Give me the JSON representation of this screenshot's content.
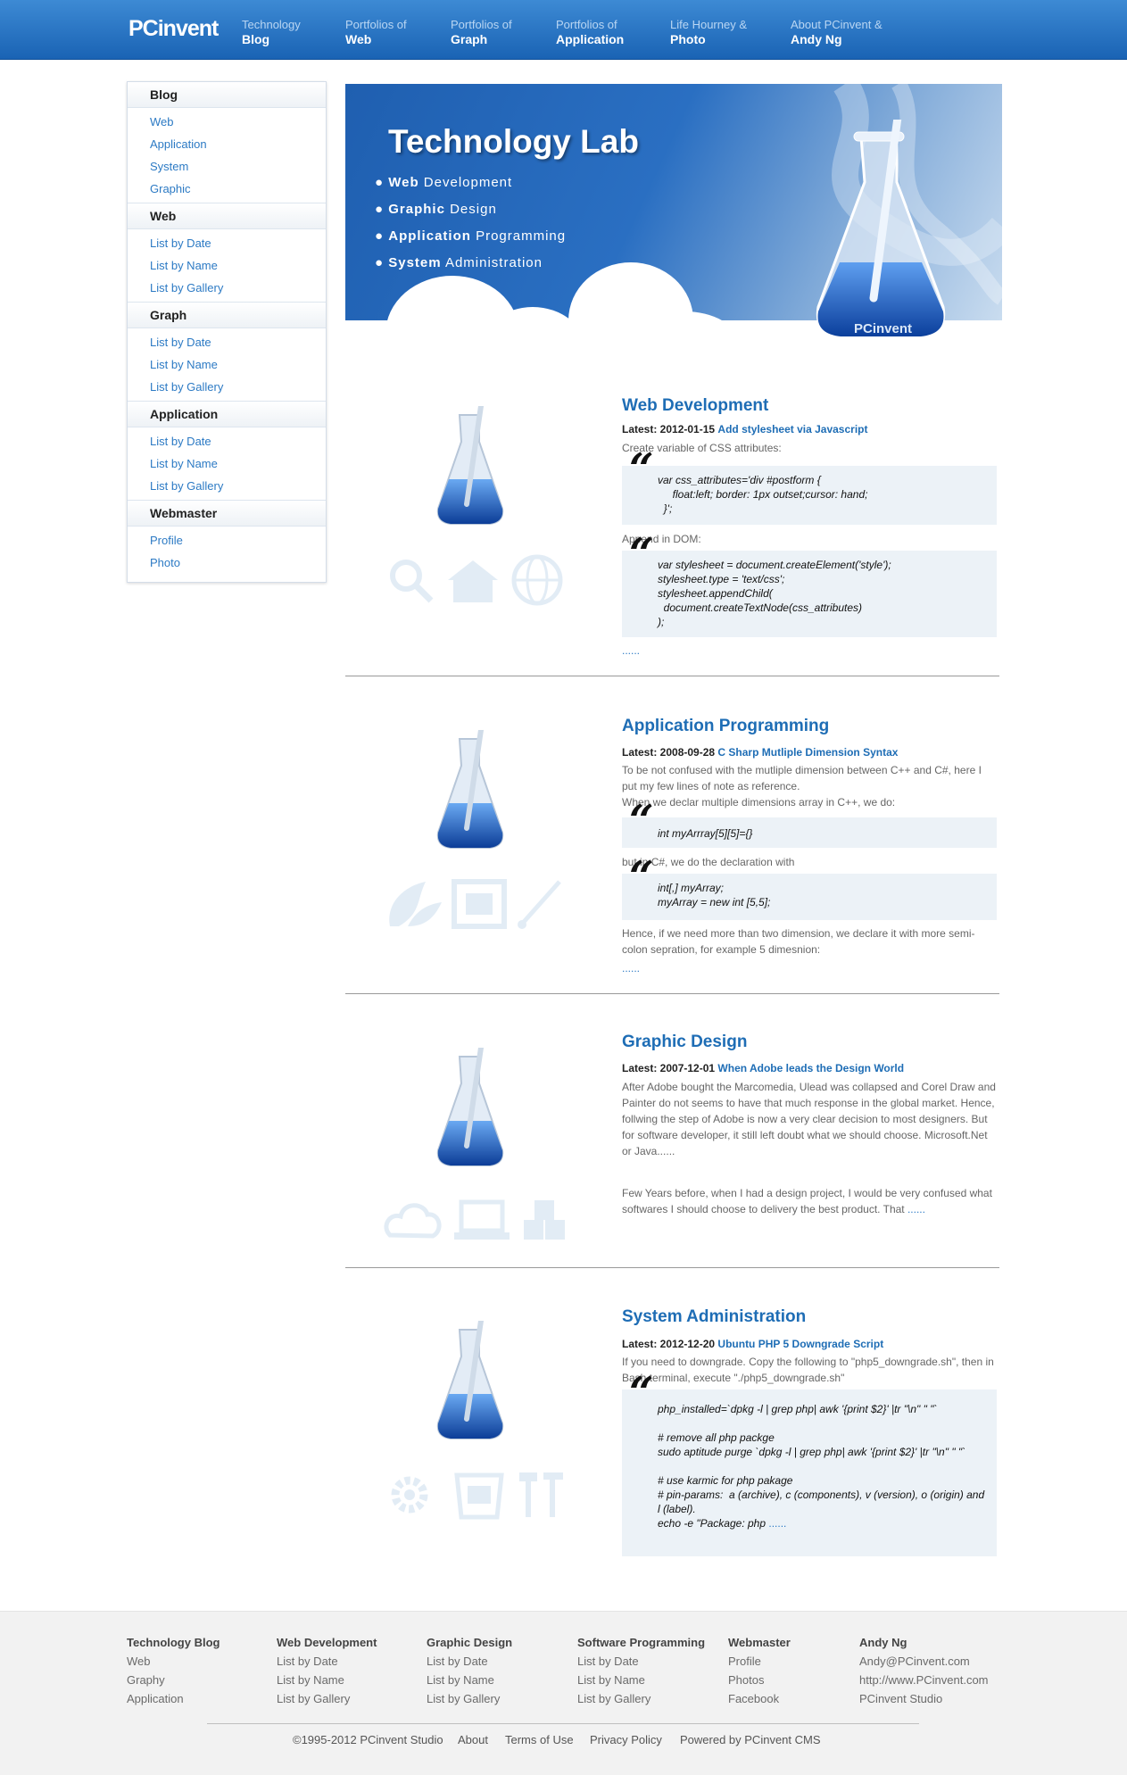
{
  "header": {
    "logo": "PCinvent",
    "nav": [
      {
        "line1": "Technology",
        "line2": "Blog"
      },
      {
        "line1": "Portfolios of",
        "line2": "Web"
      },
      {
        "line1": "Portfolios of",
        "line2": "Graph"
      },
      {
        "line1": "Portfolios of",
        "line2": "Application"
      },
      {
        "line1": "Life Hourney &",
        "line2": "Photo"
      },
      {
        "line1": "About PCinvent &",
        "line2": "Andy Ng"
      }
    ]
  },
  "sidebar": {
    "groups": [
      {
        "title": "Blog",
        "items": [
          "Web",
          "Application",
          "System",
          "Graphic"
        ]
      },
      {
        "title": "Web",
        "items": [
          "List by Date",
          "List by Name",
          "List by Gallery"
        ]
      },
      {
        "title": "Graph",
        "items": [
          "List by Date",
          "List by Name",
          "List by Gallery"
        ]
      },
      {
        "title": "Application",
        "items": [
          "List by Date",
          "List by Name",
          "List by Gallery"
        ]
      },
      {
        "title": "Webmaster",
        "items": [
          "Profile",
          "Photo"
        ]
      }
    ]
  },
  "banner": {
    "title": "Technology Lab",
    "bullets": [
      {
        "bold": "Web",
        "rest": " Development"
      },
      {
        "bold": "Graphic",
        "rest": " Design"
      },
      {
        "bold": "Application",
        "rest": " Programming"
      },
      {
        "bold": "System",
        "rest": " Administration"
      }
    ],
    "flask_label": "PCinvent"
  },
  "sections": [
    {
      "title": "Web Development",
      "latest_label": "Latest: 2012-01-15",
      "latest_link": "Add stylesheet via Javascript",
      "p1": "Create variable of CSS attributes:",
      "code1": "var css_attributes='div #postform {\n     float:left; border: 1px outset;cursor: hand;\n  }';",
      "p2": "Append in DOM:",
      "code2": "var stylesheet = document.createElement('style');\nstylesheet.type = 'text/css';\nstylesheet.appendChild(\n  document.createTextNode(css_attributes)\n);",
      "more": "......"
    },
    {
      "title": "Application Programming",
      "latest_label": "Latest: 2008-09-28",
      "latest_link": "C Sharp Mutliple Dimension Syntax",
      "p1": "To be not confused with the mutliple dimension between C++ and C#, here I put my few lines of note as reference.\nWhen we declar multiple dimensions array in C++, we do:",
      "code1": "int myArrray[5][5]={}",
      "p2": "but in C#, we do the declaration with",
      "code2": "int[,] myArray;\nmyArray = new int [5,5];",
      "p3": "Hence, if we need more than two dimension, we declare it with more semi-colon sepration, for example 5 dimesnion:",
      "more": "......"
    },
    {
      "title": "Graphic Design",
      "latest_label": "Latest: 2007-12-01",
      "latest_link": "When Adobe leads the Design World",
      "p1": "After Adobe bought the Marcomedia, Ulead was collapsed and Corel Draw and Painter do not seems to have that much response in the global market. Hence, follwing the step of Adobe is now a very clear decision to most designers. But for software developer, it still left doubt what we should choose. Microsoft.Net or Java......",
      "p2": "Few Years before, when I had a design project, I would be very confused what softwares I should choose to delivery the best product. That",
      "more": "......"
    },
    {
      "title": "System Administration",
      "latest_label": "Latest: 2012-12-20",
      "latest_link": "Ubuntu PHP 5 Downgrade Script",
      "p1": "If you need to downgrade. Copy the following to \"php5_downgrade.sh\", then in Bash terminal, execute \"./php5_downgrade.sh\"",
      "code1": "php_installed=`dpkg -l | grep php| awk '{print $2}' |tr \"\\n\" \" \"`\n\n# remove all php packge\nsudo aptitude purge `dpkg -l | grep php| awk '{print $2}' |tr \"\\n\" \" \"`\n\n# use karmic for php pakage\n# pin-params:  a (archive), c (components), v (version), o (origin) and l (label).\necho -e \"Package: php",
      "more": "......"
    }
  ],
  "footer": {
    "columns": [
      {
        "title": "Technology Blog",
        "items": [
          "Web",
          "Graphy",
          "Application"
        ]
      },
      {
        "title": "Web Development",
        "items": [
          "List by Date",
          "List by Name",
          "List by Gallery"
        ]
      },
      {
        "title": "Graphic Design",
        "items": [
          "List by Date",
          "List by Name",
          "List by Gallery"
        ]
      },
      {
        "title": "Software Programming",
        "items": [
          "List by Date",
          "List by Name",
          "List by Gallery"
        ]
      },
      {
        "title": "Webmaster",
        "items": [
          "Profile",
          "Photos",
          "Facebook"
        ]
      },
      {
        "title": "Andy Ng",
        "items": [
          "Andy@PCinvent.com",
          "http://www.PCinvent.com",
          "PCinvent Studio"
        ]
      }
    ],
    "copyright": "©1995-2012 PCinvent Studio",
    "links": [
      "About",
      "Terms of Use",
      "Privacy Policy",
      "Powered by PCinvent CMS"
    ]
  }
}
